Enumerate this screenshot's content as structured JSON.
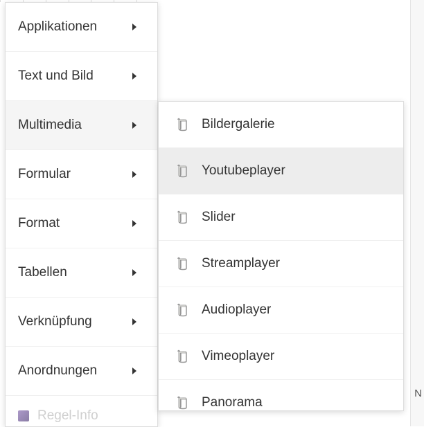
{
  "mainMenu": {
    "items": [
      {
        "label": "Applikationen",
        "active": false
      },
      {
        "label": "Text und Bild",
        "active": false
      },
      {
        "label": "Multimedia",
        "active": true
      },
      {
        "label": "Formular",
        "active": false
      },
      {
        "label": "Format",
        "active": false
      },
      {
        "label": "Tabellen",
        "active": false
      },
      {
        "label": "Verknüpfung",
        "active": false
      },
      {
        "label": "Anordnungen",
        "active": false
      }
    ],
    "bottomItem": {
      "label": "Regel-Info"
    }
  },
  "subMenu": {
    "items": [
      {
        "label": "Bildergalerie",
        "hover": false
      },
      {
        "label": "Youtubeplayer",
        "hover": true
      },
      {
        "label": "Slider",
        "hover": false
      },
      {
        "label": "Streamplayer",
        "hover": false
      },
      {
        "label": "Audioplayer",
        "hover": false
      },
      {
        "label": "Vimeoplayer",
        "hover": false
      },
      {
        "label": "Panorama",
        "hover": false
      }
    ]
  },
  "background": {
    "rightFragment": "N"
  }
}
